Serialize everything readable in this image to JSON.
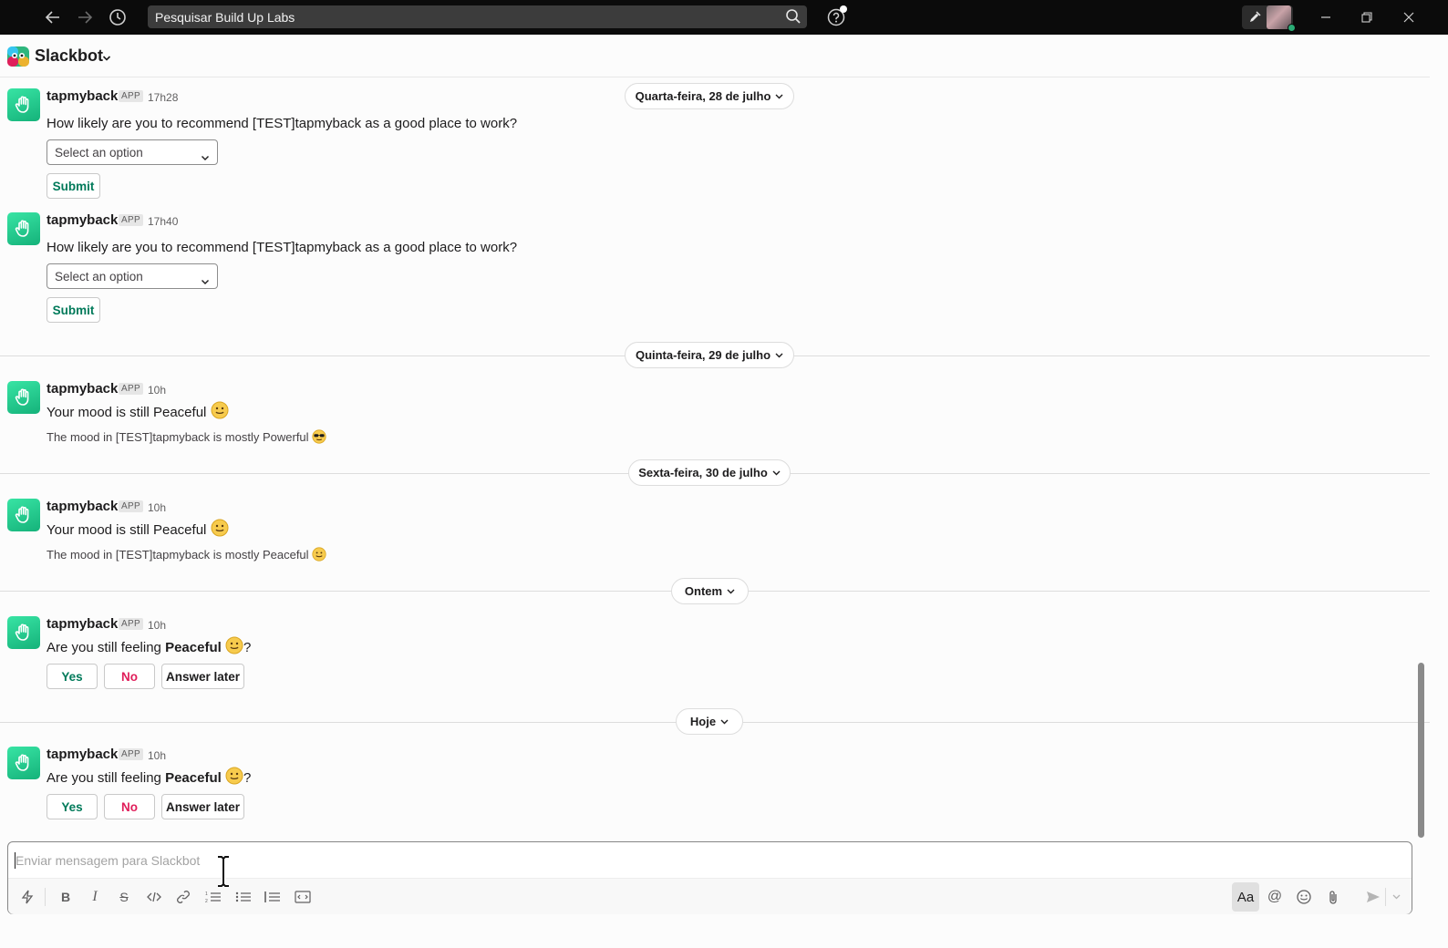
{
  "topbar": {
    "search_placeholder": "Pesquisar Build Up Labs"
  },
  "channel": {
    "title": "Slackbot"
  },
  "messages": [
    {
      "sender": "tapmyback",
      "badge": "APP",
      "time": "17h28",
      "text": "How likely are you to recommend [TEST]tapmyback as a good place to work?",
      "select_placeholder": "Select an option",
      "submit_label": "Submit"
    },
    {
      "sender": "tapmyback",
      "badge": "APP",
      "time": "17h40",
      "text": "How likely are you to recommend [TEST]tapmyback as a good place to work?",
      "select_placeholder": "Select an option",
      "submit_label": "Submit"
    },
    {
      "sender": "tapmyback",
      "badge": "APP",
      "time": "10h",
      "text": "Your mood is still Peaceful",
      "subtext": "The mood in [TEST]tapmyback is mostly Powerful"
    },
    {
      "sender": "tapmyback",
      "badge": "APP",
      "time": "10h",
      "text": "Your mood is still Peaceful",
      "subtext": "The mood in [TEST]tapmyback is mostly Peaceful"
    },
    {
      "sender": "tapmyback",
      "badge": "APP",
      "time": "10h",
      "text_prefix": "Are you still feeling ",
      "text_bold": "Peaceful",
      "text_suffix": "?",
      "yes_label": "Yes",
      "no_label": "No",
      "later_label": "Answer later"
    },
    {
      "sender": "tapmyback",
      "badge": "APP",
      "time": "10h",
      "text_prefix": "Are you still feeling ",
      "text_bold": "Peaceful",
      "text_suffix": "?",
      "yes_label": "Yes",
      "no_label": "No",
      "later_label": "Answer later"
    }
  ],
  "dates": [
    "Quarta-feira, 28 de julho",
    "Quinta-feira, 29 de julho",
    "Sexta-feira, 30 de julho",
    "Ontem",
    "Hoje"
  ],
  "composer": {
    "placeholder": "Enviar mensagem para Slackbot",
    "format_label": "Aa"
  },
  "colors": {
    "accent_green": "#007a5a",
    "danger_red": "#e01e5a",
    "bot_avatar": "#1fc58b",
    "online": "#2bac76"
  },
  "icons": [
    "back-arrow-icon",
    "forward-arrow-icon",
    "history-icon",
    "search-icon",
    "help-icon",
    "rocket-icon",
    "minimize-icon",
    "restore-icon",
    "close-icon",
    "chevron-down-icon",
    "hand-icon",
    "smile-emoji-icon",
    "sunglasses-emoji-icon",
    "shortcuts-icon",
    "bold-icon",
    "italic-icon",
    "strikethrough-icon",
    "code-icon",
    "link-icon",
    "ordered-list-icon",
    "bullet-list-icon",
    "blockquote-icon",
    "code-block-icon",
    "mention-icon",
    "emoji-icon",
    "attach-icon",
    "send-icon"
  ]
}
